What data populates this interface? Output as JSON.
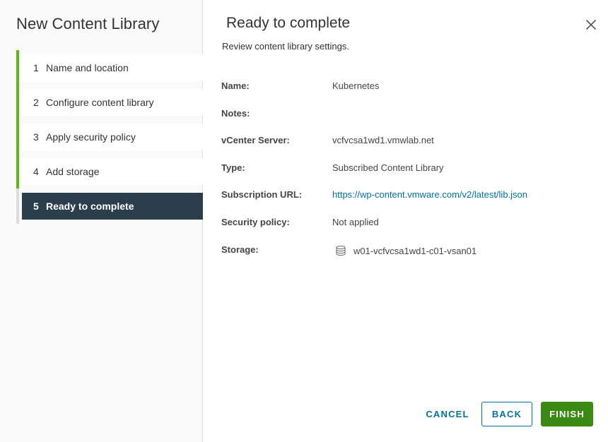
{
  "sidebar": {
    "title": "New Content Library",
    "steps": [
      {
        "num": "1",
        "label": "Name and location"
      },
      {
        "num": "2",
        "label": "Configure content library"
      },
      {
        "num": "3",
        "label": "Apply security policy"
      },
      {
        "num": "4",
        "label": "Add storage"
      },
      {
        "num": "5",
        "label": "Ready to complete"
      }
    ],
    "active_step": 5
  },
  "main": {
    "title": "Ready to complete",
    "subtitle": "Review content library settings.",
    "fields": {
      "name": {
        "label": "Name:",
        "value": "Kubernetes"
      },
      "notes": {
        "label": "Notes:",
        "value": ""
      },
      "vcenter": {
        "label": "vCenter Server:",
        "value": "vcfvcsa1wd1.vmwlab.net"
      },
      "type": {
        "label": "Type:",
        "value": "Subscribed Content Library"
      },
      "url": {
        "label": "Subscription URL:",
        "value": "https://wp-content.vmware.com/v2/latest/lib.json"
      },
      "security": {
        "label": "Security policy:",
        "value": "Not applied"
      },
      "storage": {
        "label": "Storage:",
        "value": "w01-vcfvcsa1wd1-c01-vsan01",
        "icon": "datastore-icon"
      }
    }
  },
  "footer": {
    "cancel_label": "CANCEL",
    "back_label": "BACK",
    "finish_label": "FINISH"
  },
  "colors": {
    "accent_green": "#5eb715",
    "active_step_bg": "#2b3e4b",
    "link_blue": "#0072a3",
    "finish_green": "#3b8a13"
  },
  "icons": {
    "close": "close-icon",
    "storage": "datastore-icon"
  }
}
